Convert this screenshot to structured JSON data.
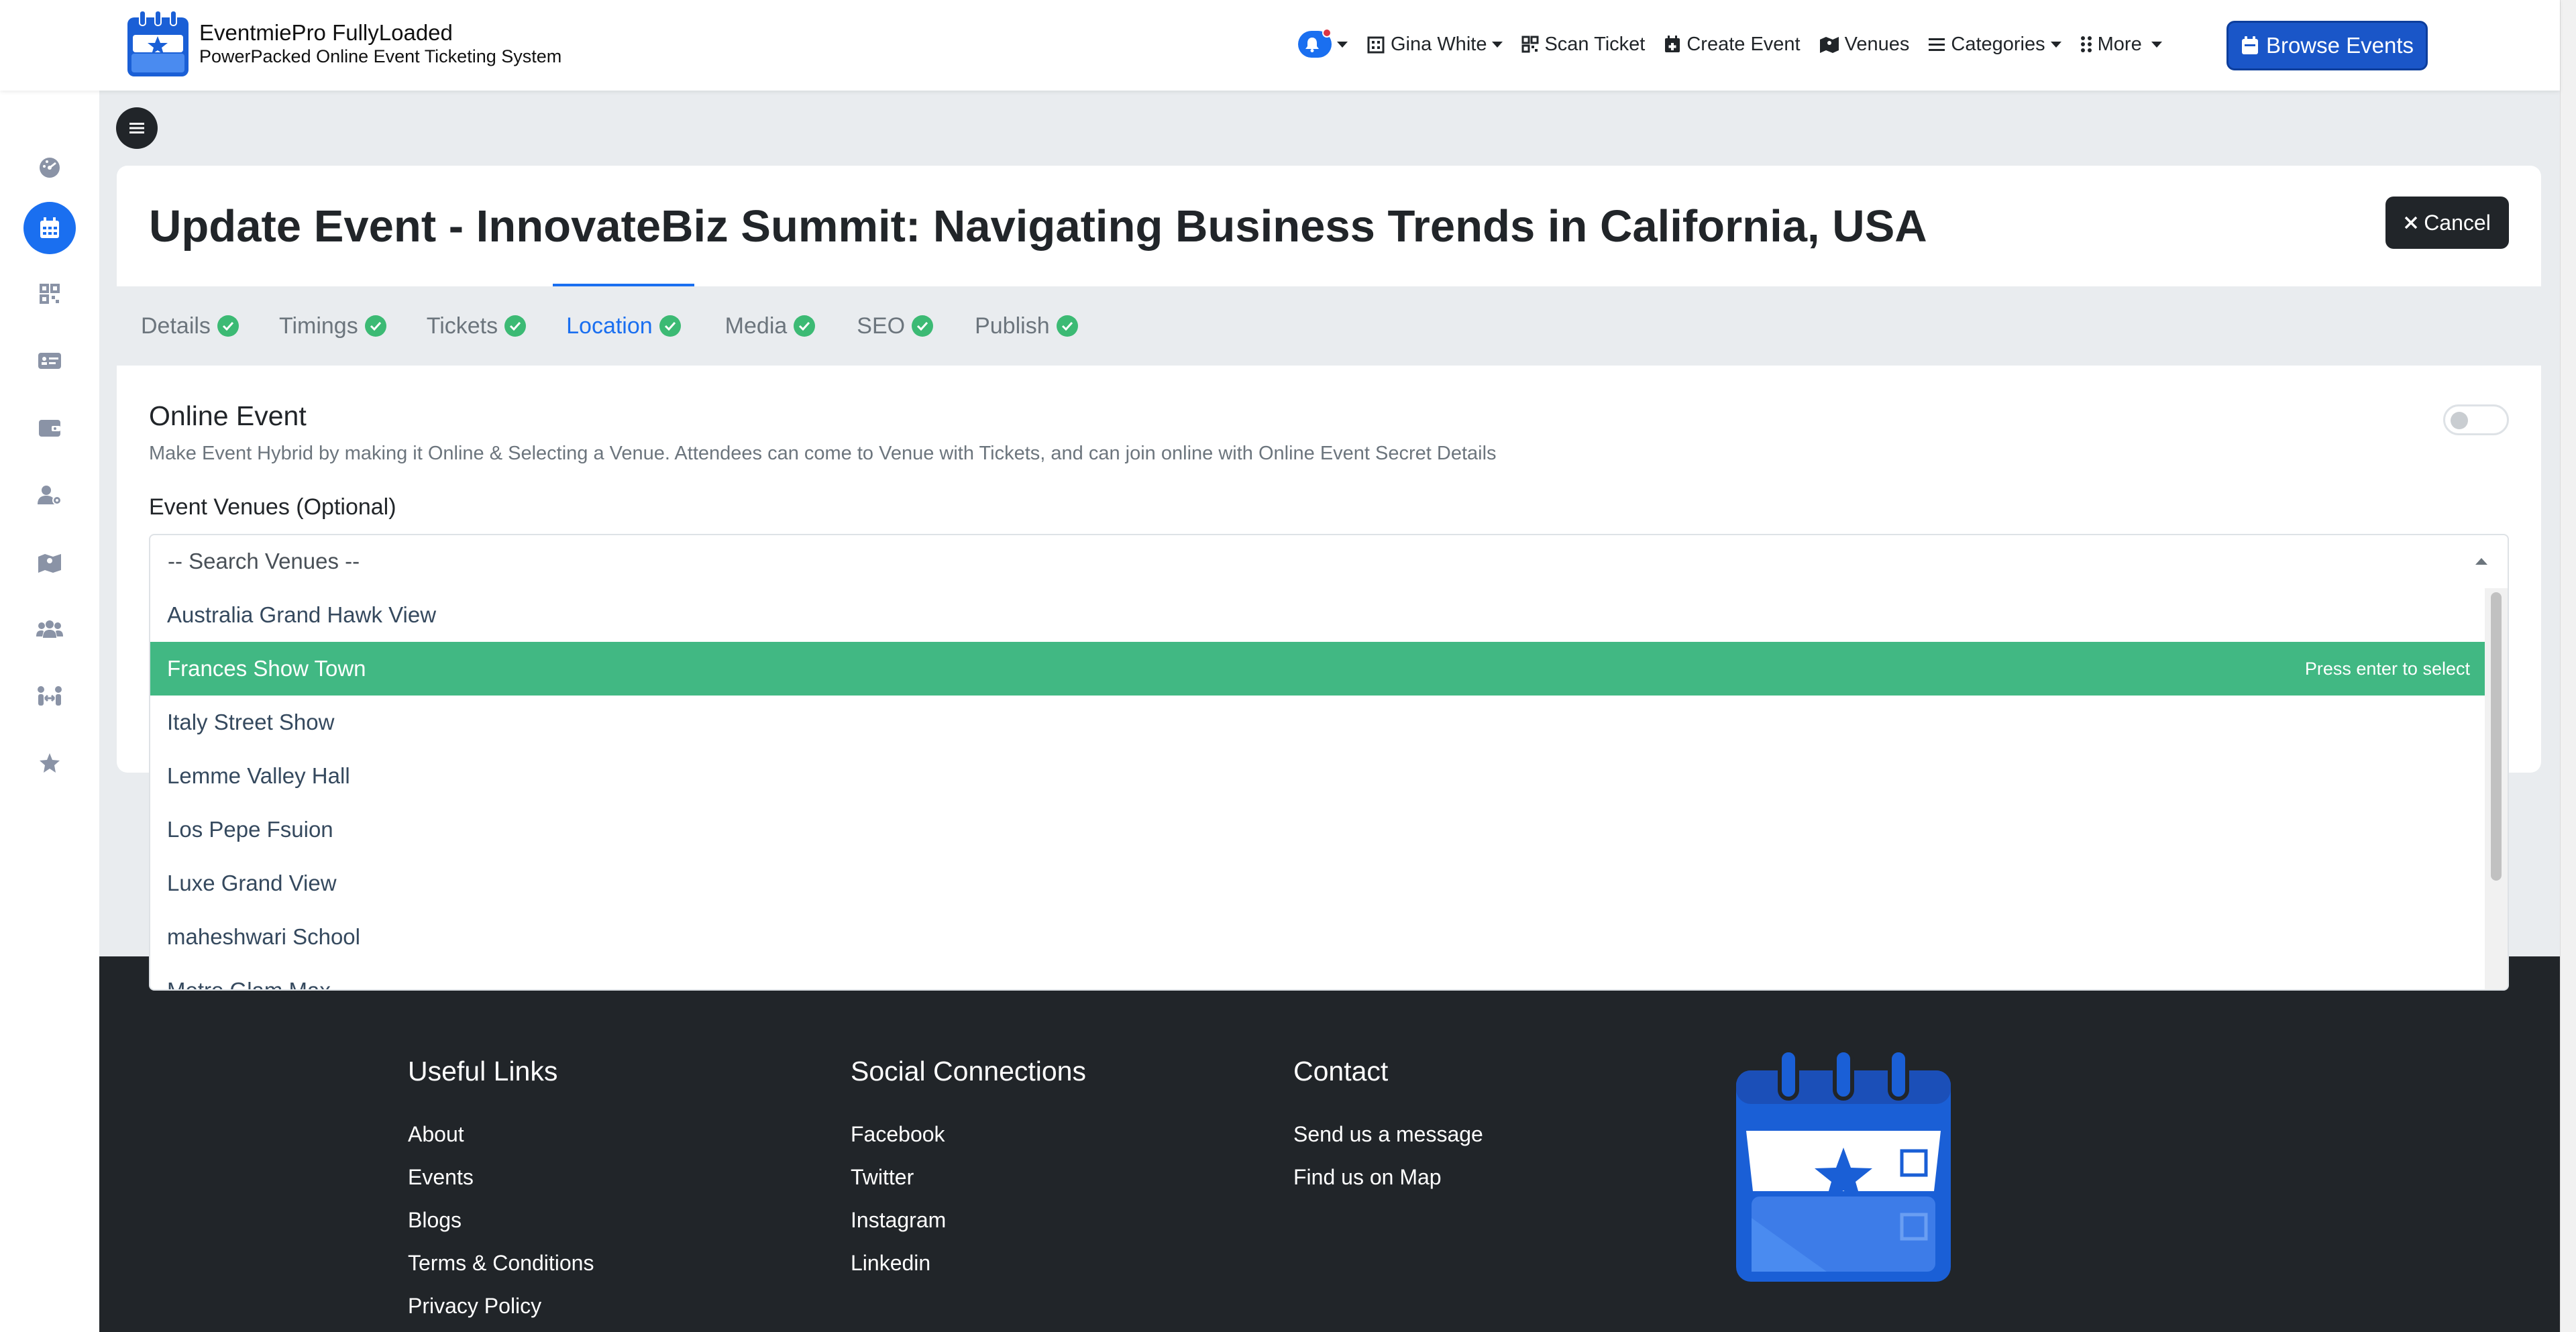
{
  "brand": {
    "title": "EventmiePro FullyLoaded",
    "subtitle": "PowerPacked Online Event Ticketing System"
  },
  "navbar": {
    "user_name": "Gina White",
    "scan_ticket": "Scan Ticket",
    "create_event": "Create Event",
    "venues": "Venues",
    "categories": "Categories",
    "more": "More",
    "browse_events": "Browse Events"
  },
  "sidebar": {
    "items": [
      "dashboard-icon",
      "calendar-icon",
      "qrcode-icon",
      "ticket-card-icon",
      "wallet-icon",
      "user-gear-icon",
      "map-icon",
      "users-icon",
      "people-arrows-icon",
      "star-icon"
    ],
    "active_index": 1
  },
  "page": {
    "title": "Update Event - InnovateBiz Summit: Navigating Business Trends in California, USA",
    "cancel_label": "Cancel"
  },
  "tabs": [
    {
      "label": "Details",
      "complete": true
    },
    {
      "label": "Timings",
      "complete": true
    },
    {
      "label": "Tickets",
      "complete": true
    },
    {
      "label": "Location",
      "complete": true,
      "active": true
    },
    {
      "label": "Media",
      "complete": true
    },
    {
      "label": "SEO",
      "complete": true
    },
    {
      "label": "Publish",
      "complete": true
    }
  ],
  "location": {
    "online_event_label": "Online Event",
    "online_event_help": "Make Event Hybrid by making it Online & Selecting a Venue. Attendees can come to Venue with Tickets, and can join online with Online Event Secret Details",
    "online_event_enabled": false,
    "venues_label": "Event Venues (Optional)",
    "venues_placeholder": "-- Search Venues --",
    "select_hint": "Press enter to select",
    "highlighted_index": 1,
    "venue_options": [
      "Australia Grand Hawk View",
      "Frances Show Town",
      "Italy Street Show",
      "Lemme Valley Hall",
      "Los Pepe Fsuion",
      "Luxe Grand View",
      "maheshwari School",
      "Metro Glam Max"
    ]
  },
  "footer": {
    "useful_links": {
      "heading": "Useful Links",
      "links": [
        "About",
        "Events",
        "Blogs",
        "Terms & Conditions",
        "Privacy Policy"
      ]
    },
    "social": {
      "heading": "Social Connections",
      "links": [
        "Facebook",
        "Twitter",
        "Instagram",
        "Linkedin"
      ]
    },
    "contact": {
      "heading": "Contact",
      "links": [
        "Send us a message",
        "Find us on Map"
      ]
    }
  },
  "colors": {
    "primary": "#1a6ff0",
    "browse_button": "#1a56c8",
    "success": "#3cba74",
    "dropdown_highlight": "#41b883",
    "dark": "#212529",
    "background": "#e9ecef"
  }
}
